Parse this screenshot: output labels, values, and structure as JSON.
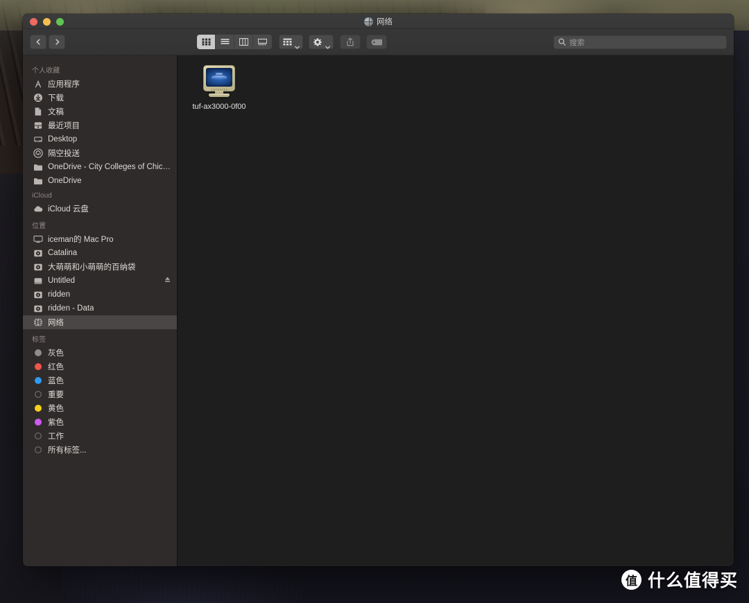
{
  "window": {
    "title": "网络",
    "title_icon": "globe-icon",
    "traffic_lights": [
      {
        "name": "close",
        "color": "#ec6a5f"
      },
      {
        "name": "minimize",
        "color": "#f4bf4f"
      },
      {
        "name": "zoom",
        "color": "#61c454"
      }
    ]
  },
  "toolbar": {
    "back_label": "后退",
    "forward_label": "前进",
    "view_modes": [
      {
        "name": "icon-view",
        "label": "图标显示",
        "active": true
      },
      {
        "name": "list-view",
        "label": "列表显示",
        "active": false
      },
      {
        "name": "column-view",
        "label": "分栏显示",
        "active": false
      },
      {
        "name": "gallery-view",
        "label": "画廊显示",
        "active": false
      }
    ],
    "group_label": "排列方式",
    "action_label": "操作",
    "share_label": "共享",
    "tag_label": "编辑标记"
  },
  "search": {
    "placeholder": "搜索",
    "value": ""
  },
  "sidebar": {
    "groups": [
      {
        "title": "个人收藏",
        "items": [
          {
            "label": "应用程序",
            "icon": "applications-icon",
            "selected": false
          },
          {
            "label": "下载",
            "icon": "downloads-icon",
            "selected": false
          },
          {
            "label": "文稿",
            "icon": "documents-icon",
            "selected": false
          },
          {
            "label": "最近项目",
            "icon": "recents-icon",
            "selected": false
          },
          {
            "label": "Desktop",
            "icon": "desktop-icon",
            "selected": false
          },
          {
            "label": "隔空投送",
            "icon": "airdrop-icon",
            "selected": false
          },
          {
            "label": "OneDrive - City Colleges of Chicago",
            "icon": "folder-icon",
            "selected": false
          },
          {
            "label": "OneDrive",
            "icon": "folder-icon",
            "selected": false
          }
        ]
      },
      {
        "title": "iCloud",
        "items": [
          {
            "label": "iCloud 云盘",
            "icon": "cloud-icon",
            "selected": false
          }
        ]
      },
      {
        "title": "位置",
        "items": [
          {
            "label": "iceman的 Mac Pro",
            "icon": "computer-icon",
            "selected": false
          },
          {
            "label": "Catalina",
            "icon": "harddisk-icon",
            "selected": false
          },
          {
            "label": "大萌萌和小萌萌的百纳袋",
            "icon": "harddisk-icon",
            "selected": false
          },
          {
            "label": "Untitled",
            "icon": "externaldisk-icon",
            "selected": false,
            "eject": true
          },
          {
            "label": "ridden",
            "icon": "harddisk-icon",
            "selected": false
          },
          {
            "label": "ridden - Data",
            "icon": "harddisk-icon",
            "selected": false
          },
          {
            "label": "网络",
            "icon": "globe-icon",
            "selected": true
          }
        ]
      },
      {
        "title": "标签",
        "items": [
          {
            "label": "灰色",
            "icon": "tag-dot",
            "color": "#8d8d8d",
            "selected": false
          },
          {
            "label": "红色",
            "icon": "tag-dot",
            "color": "#f0554c",
            "selected": false
          },
          {
            "label": "蓝色",
            "icon": "tag-dot",
            "color": "#2f9bf0",
            "selected": false
          },
          {
            "label": "重要",
            "icon": "tag-dot-hollow",
            "color": "",
            "selected": false
          },
          {
            "label": "黄色",
            "icon": "tag-dot",
            "color": "#f5d219",
            "selected": false
          },
          {
            "label": "紫色",
            "icon": "tag-dot",
            "color": "#cc5bf0",
            "selected": false
          },
          {
            "label": "工作",
            "icon": "tag-dot-hollow",
            "color": "",
            "selected": false
          },
          {
            "label": "所有标签...",
            "icon": "tag-dot-hollow",
            "color": "",
            "selected": false
          }
        ]
      }
    ]
  },
  "content": {
    "items": [
      {
        "label": "tuf-ax3000-0f00",
        "icon": "network-server-icon"
      }
    ]
  },
  "watermark": {
    "logo": "值",
    "text": "什么值得买"
  }
}
